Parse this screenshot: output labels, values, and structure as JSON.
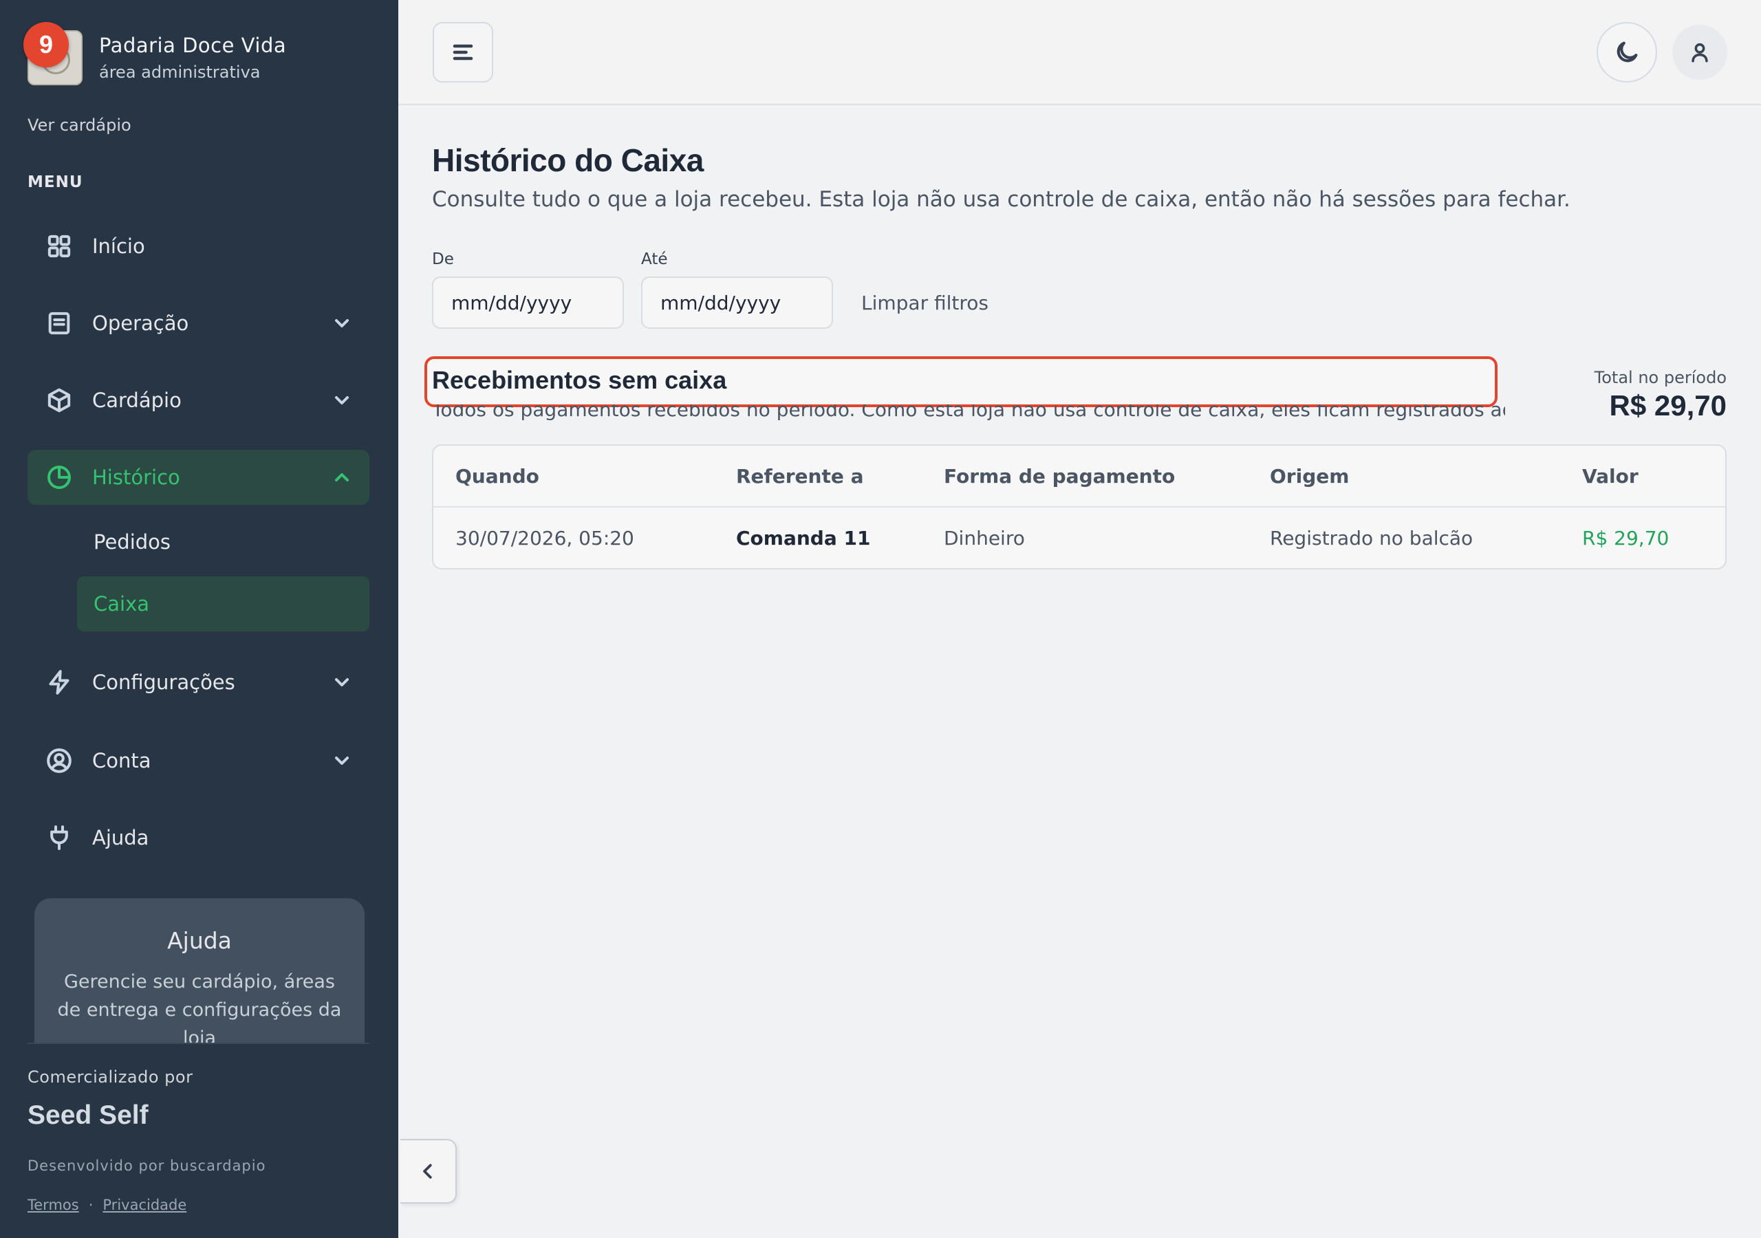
{
  "brand": {
    "name": "Padaria Doce Vida",
    "subtitle": "área administrativa",
    "notification_count": "9"
  },
  "sidebar": {
    "view_menu_link": "Ver cardápio",
    "menu_label": "MENU",
    "items": [
      {
        "label": "Início",
        "icon": "grid-icon",
        "expandable": false
      },
      {
        "label": "Operação",
        "icon": "clipboard-icon",
        "expandable": true
      },
      {
        "label": "Cardápio",
        "icon": "box-icon",
        "expandable": true
      },
      {
        "label": "Histórico",
        "icon": "pie-chart-icon",
        "expandable": true,
        "active": true
      },
      {
        "label": "Configurações",
        "icon": "bolt-icon",
        "expandable": true
      },
      {
        "label": "Conta",
        "icon": "user-circle-icon",
        "expandable": true
      },
      {
        "label": "Ajuda",
        "icon": "plug-icon",
        "expandable": false
      }
    ],
    "subitems": [
      {
        "label": "Pedidos"
      },
      {
        "label": "Caixa",
        "active": true
      }
    ],
    "help_card": {
      "title": "Ajuda",
      "text": "Gerencie seu cardápio, áreas de entrega e configurações da loja"
    },
    "footer": {
      "commercialized_by": "Comercializado por",
      "vendor": "Seed Self",
      "developed_by": "Desenvolvido por buscardapio",
      "terms": "Termos",
      "separator": "·",
      "privacy": "Privacidade"
    }
  },
  "page": {
    "title": "Histórico do Caixa",
    "subtitle": "Consulte tudo o que a loja recebeu. Esta loja não usa controle de caixa, então não há sessões para fechar."
  },
  "filters": {
    "from_label": "De",
    "from_placeholder": "mm/dd/yyyy",
    "to_label": "Até",
    "to_placeholder": "mm/dd/yyyy",
    "clear_label": "Limpar filtros"
  },
  "section": {
    "title": "Recebimentos sem caixa",
    "description": "Todos os pagamentos recebidos no período. Como esta loja não usa controle de caixa, eles ficam registrados aqui.",
    "total_label": "Total no período",
    "total_value": "R$ 29,70"
  },
  "table": {
    "columns": [
      "Quando",
      "Referente a",
      "Forma de pagamento",
      "Origem",
      "Valor"
    ],
    "rows": [
      [
        "30/07/2026, 05:20",
        "Comanda 11",
        "Dinheiro",
        "Registrado no balcão",
        "R$ 29,70"
      ]
    ]
  },
  "colors": {
    "sidebar_bg": "#283544",
    "accent_green": "#34c370",
    "highlight_red": "#e2452e"
  }
}
